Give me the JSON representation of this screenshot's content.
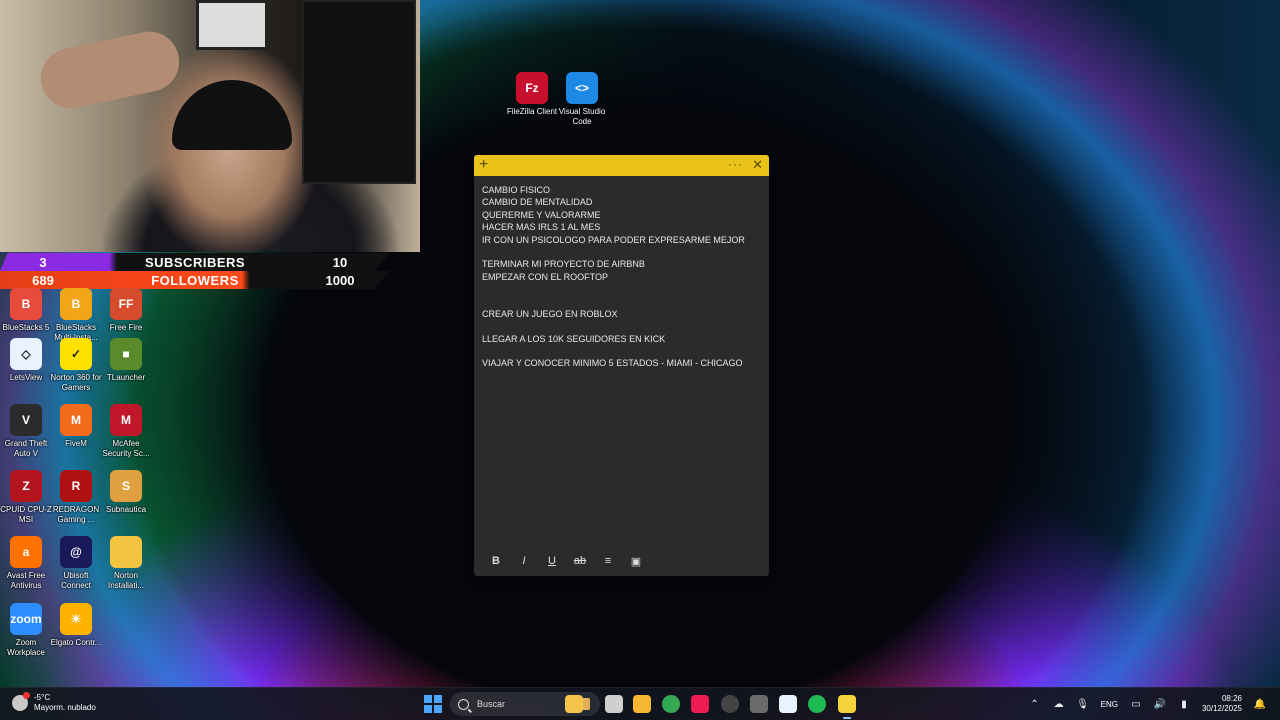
{
  "webcam": {
    "subscribers": {
      "current": "3",
      "label": "SUBSCRIBERS",
      "goal": "10"
    },
    "followers": {
      "current": "689",
      "label": "FOLLOWERS",
      "goal": "1000"
    },
    "colors": {
      "subscribers": "#8a2be2",
      "followers": "#ff4a18"
    }
  },
  "desktop_icons": [
    {
      "name": "filezilla",
      "label": "FileZilla Client",
      "icon": "filezilla-icon",
      "color": "#c8102e",
      "glyph": "Fz"
    },
    {
      "name": "vscode",
      "label": "Visual Studio Code",
      "icon": "vscode-icon",
      "color": "#1e88e5",
      "glyph": "<>"
    },
    {
      "name": "bluestacks5",
      "label": "BlueStacks 5",
      "icon": "bluestacks-icon",
      "color": "#e84a3c",
      "glyph": "B"
    },
    {
      "name": "bluestacks-multi",
      "label": "BlueStacks Multi-Insta...",
      "icon": "bluestacks-multi-icon",
      "color": "#f2a516",
      "glyph": "B"
    },
    {
      "name": "freefire",
      "label": "Free Fire",
      "icon": "freefire-icon",
      "color": "#d64b2c",
      "glyph": "FF"
    },
    {
      "name": "letsview",
      "label": "LetsView",
      "icon": "letsview-icon",
      "color": "#e9f2ff",
      "glyph": "◇"
    },
    {
      "name": "norton360",
      "label": "Norton 360 for Gamers",
      "icon": "norton-icon",
      "color": "#ffe100",
      "glyph": "✓"
    },
    {
      "name": "tlauncher",
      "label": "TLauncher",
      "icon": "tlauncher-icon",
      "color": "#5a8a2a",
      "glyph": "■"
    },
    {
      "name": "gta5",
      "label": "Grand Theft Auto V",
      "icon": "gta-icon",
      "color": "#2b2b2b",
      "glyph": "V"
    },
    {
      "name": "fivem",
      "label": "FiveM",
      "icon": "fivem-icon",
      "color": "#f26a1b",
      "glyph": "M"
    },
    {
      "name": "mcafee",
      "label": "McAfee Security Sc...",
      "icon": "mcafee-icon",
      "color": "#c0182a",
      "glyph": "M"
    },
    {
      "name": "cpuz",
      "label": "CPUID CPU-Z MSI",
      "icon": "cpuz-icon",
      "color": "#b3141d",
      "glyph": "Z"
    },
    {
      "name": "redragon",
      "label": "REDRAGON Gaming ...",
      "icon": "redragon-icon",
      "color": "#b01010",
      "glyph": "R"
    },
    {
      "name": "subnautica",
      "label": "Subnautica",
      "icon": "subnautica-icon",
      "color": "#e0a040",
      "glyph": "S"
    },
    {
      "name": "avast",
      "label": "Avast Free Antivirus",
      "icon": "avast-icon",
      "color": "#ff7100",
      "glyph": "a"
    },
    {
      "name": "ubisoft",
      "label": "Ubisoft Connect",
      "icon": "ubisoft-icon",
      "color": "#1a1a5a",
      "glyph": "@"
    },
    {
      "name": "norton-install",
      "label": "Norton Installati...",
      "icon": "folder-icon",
      "color": "#f5c342",
      "glyph": ""
    },
    {
      "name": "zoom",
      "label": "Zoom Workplace",
      "icon": "zoom-icon",
      "color": "#2d8cff",
      "glyph": "zoom"
    },
    {
      "name": "elgato",
      "label": "Elgato Contr...",
      "icon": "elgato-icon",
      "color": "#ffb300",
      "glyph": "☀"
    }
  ],
  "note": {
    "lines": [
      "CAMBIO FISICO",
      "CAMBIO DE MENTALIDAD",
      "QUERERME Y VALORARME",
      "HACER MAS IRLS 1 AL MES",
      "IR CON UN PSICOLOGO PARA PODER EXPRESARME MEJOR",
      "",
      "TERMINAR MI PROYECTO DE AIRBNB",
      "EMPEZAR CON EL ROOFTOP",
      "",
      "",
      "CREAR UN JUEGO EN ROBLOX",
      "",
      "LLEGAR A LOS 10K SEGUIDORES EN KICK",
      "",
      "VIAJAR Y CONOCER MINIMO 5 ESTADOS - MIAMI - CHICAGO"
    ],
    "toolbar": [
      "B",
      "I",
      "U",
      "ab",
      "≡",
      "▣"
    ],
    "accent": "#e9c21a"
  },
  "taskbar": {
    "weather_temp": "-5°C",
    "weather_desc": "Mayorm. nublado",
    "search_placeholder": "Buscar",
    "apps": [
      {
        "name": "file-explorer",
        "color": "#f3c34a"
      },
      {
        "name": "task-view",
        "color": "#cfcfcf"
      },
      {
        "name": "folder",
        "color": "#f7b733"
      },
      {
        "name": "chrome",
        "color": "#34a853"
      },
      {
        "name": "tiktok",
        "color": "#ee1d52"
      },
      {
        "name": "obs",
        "color": "#444"
      },
      {
        "name": "steam-deck",
        "color": "#6a6a6a"
      },
      {
        "name": "letsview",
        "color": "#e9f2ff"
      },
      {
        "name": "spotify",
        "color": "#1db954"
      },
      {
        "name": "sticky-notes",
        "color": "#f5d33c"
      }
    ],
    "lang": "ENG",
    "time": "08:26",
    "date": "30/12/2025"
  }
}
